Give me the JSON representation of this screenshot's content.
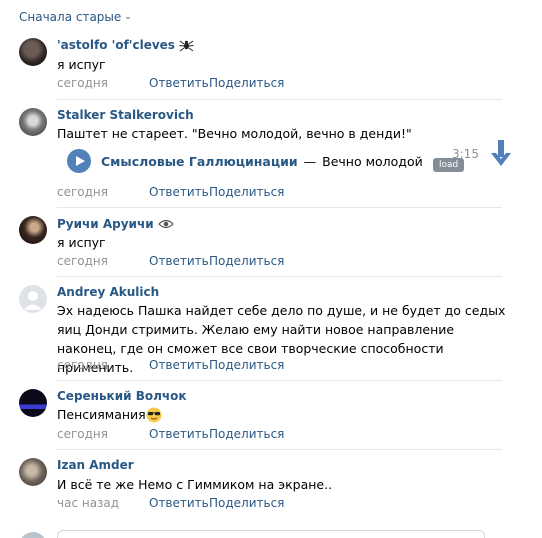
{
  "sort": {
    "label": "Сначала старые"
  },
  "comments": [
    {
      "author": "'astolfo 'of'cleves",
      "text": "я испуг",
      "time": "сегодня",
      "reply": "Ответить",
      "share": "Поделиться"
    },
    {
      "author": "Stalker Stalkerovich",
      "text": "Паштет не стареет. \"Вечно молодой, вечно в денди!\"",
      "time": "сегодня",
      "reply": "Ответить",
      "share": "Поделиться",
      "audio": {
        "artist": "Смысловые Галлюцинации",
        "dash": "—",
        "title": "Вечно молодой",
        "duration": "3:15",
        "badge": "load"
      }
    },
    {
      "author": "Руичи Аруичи",
      "text": "я испуг",
      "time": "сегодня",
      "reply": "Ответить",
      "share": "Поделиться"
    },
    {
      "author": "Andrey Akulich",
      "text": "Эх надеюсь Пашка найдет себе дело по душе, и не будет до седых яиц Донди стримить. Желаю ему найти новое направление наконец, где он сможет все свои творческие способности применить.",
      "time": "сегодня",
      "reply": "Ответить",
      "share": "Поделиться"
    },
    {
      "author": "Серенький Волчок",
      "text": "Пенсиямания",
      "time": "сегодня",
      "reply": "Ответить",
      "share": "Поделиться"
    },
    {
      "author": "Izan Amder",
      "text": "И всё те же Немо с Гиммиком на экране..",
      "time": "час назад",
      "reply": "Ответить",
      "share": "Поделиться"
    }
  ],
  "colors": {
    "link": "#2a5885",
    "muted": "#939393",
    "separator": "#e7e8ec",
    "play": "#5181b8",
    "download": "#5181b8"
  },
  "icons": {
    "author_0_badge": "spider-icon",
    "author_2_badge": "eye-icon",
    "comment_4_emoji": "sunglasses-emoji-icon",
    "audio_download": "download-arrow-icon"
  }
}
